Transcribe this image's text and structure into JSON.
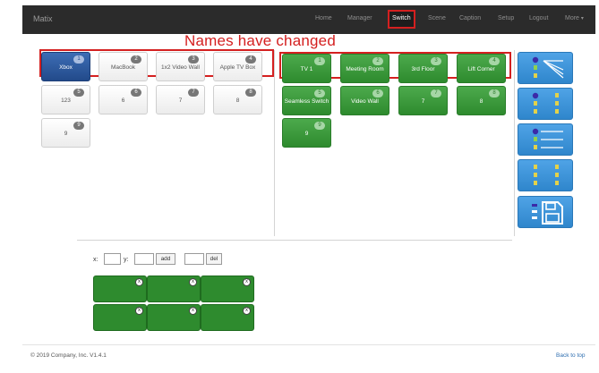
{
  "navbar": {
    "brand": "Matix",
    "items": [
      "Home",
      "Manager",
      "Switch",
      "Scene",
      "Caption",
      "Setup",
      "Logout",
      "More"
    ],
    "active": "Switch"
  },
  "annotation": "Names have changed",
  "sources": [
    {
      "label": "Xbox",
      "num": "1",
      "selected": true
    },
    {
      "label": "MacBook",
      "num": "2"
    },
    {
      "label": "1x2 Video Wall",
      "num": "3"
    },
    {
      "label": "Apple TV Box",
      "num": "4"
    },
    {
      "label": "123",
      "num": "5"
    },
    {
      "label": "6",
      "num": "6"
    },
    {
      "label": "7",
      "num": "7"
    },
    {
      "label": "8",
      "num": "8"
    },
    {
      "label": "9",
      "num": "9"
    }
  ],
  "destinations": [
    {
      "label": "TV 1",
      "num": "1"
    },
    {
      "label": "Meeting Room",
      "num": "2"
    },
    {
      "label": "3rd Floor",
      "num": "3"
    },
    {
      "label": "Lift Corner",
      "num": "4"
    },
    {
      "label": "Seamless Switch",
      "num": "5"
    },
    {
      "label": "Video Wall",
      "num": "6"
    },
    {
      "label": "7",
      "num": "7"
    },
    {
      "label": "8",
      "num": "8"
    },
    {
      "label": "9",
      "num": "9"
    }
  ],
  "mode_buttons": [
    {
      "icon": "one-to-many-icon",
      "nums": [
        "1",
        "2",
        "3"
      ],
      "color": "#2f86cc"
    },
    {
      "icon": "one-to-one-icon",
      "nums": [
        "1",
        "2",
        "3"
      ],
      "color": "#2f86cc"
    },
    {
      "icon": "line-routing-icon",
      "nums": [
        "1",
        "2",
        "3"
      ],
      "color": "#2f86cc"
    },
    {
      "icon": "matrix-pairs-icon",
      "nums": [
        "1",
        "2",
        "3"
      ],
      "color": "#2f86cc"
    },
    {
      "icon": "save-icon",
      "color": "#2f86cc"
    }
  ],
  "layout_controls": {
    "x_label": "x:",
    "y_label": "y:",
    "add_label": "add",
    "del_label": "del"
  },
  "video_wall": {
    "close_glyph": "x",
    "cells": 6
  },
  "footer": {
    "copyright": "© 2019 Company, Inc. V1.4.1",
    "back_to_top": "Back to top"
  },
  "colors": {
    "navbar_bg": "#2b2b2b",
    "source_selected": "#224a8a",
    "destination": "#2e8b2e",
    "mode_button": "#2f86cc",
    "annotation": "#d42020"
  }
}
